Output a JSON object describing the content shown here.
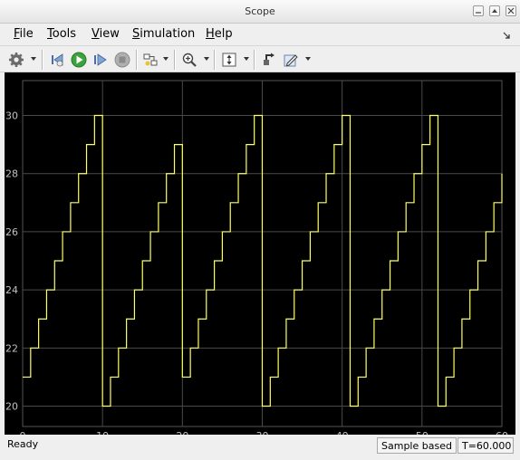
{
  "window": {
    "title": "Scope"
  },
  "menu": {
    "items": [
      {
        "label": "File",
        "u": "F",
        "rest": "ile"
      },
      {
        "label": "Tools",
        "u": "T",
        "rest": "ools"
      },
      {
        "label": "View",
        "u": "V",
        "rest": "iew"
      },
      {
        "label": "Simulation",
        "u": "S",
        "rest": "imulation"
      },
      {
        "label": "Help",
        "u": "H",
        "rest": "elp"
      }
    ]
  },
  "toolbar": {
    "buttons": [
      {
        "name": "settings",
        "icon": "gear-icon",
        "has_dropdown": true
      },
      {
        "name": "step-back",
        "icon": "step-back-icon",
        "has_dropdown": false
      },
      {
        "name": "run",
        "icon": "play-icon",
        "has_dropdown": false
      },
      {
        "name": "step-forward",
        "icon": "step-forward-icon",
        "has_dropdown": false
      },
      {
        "name": "stop",
        "icon": "stop-icon",
        "has_dropdown": false
      },
      {
        "name": "highlight-block",
        "icon": "highlight-block-icon",
        "has_dropdown": true
      },
      {
        "name": "zoom",
        "icon": "zoom-in-icon",
        "has_dropdown": true
      },
      {
        "name": "scale-axes",
        "icon": "scale-axes-icon",
        "has_dropdown": true
      },
      {
        "name": "restore",
        "icon": "restore-icon",
        "has_dropdown": false
      },
      {
        "name": "style",
        "icon": "pencil-icon",
        "has_dropdown": true
      }
    ]
  },
  "chart_data": {
    "type": "line",
    "step": true,
    "title": "",
    "xlabel": "",
    "ylabel": "",
    "xlim": [
      0,
      60
    ],
    "ylim": [
      19.3,
      31.2
    ],
    "x_ticks": [
      0,
      10,
      20,
      30,
      40,
      50,
      60
    ],
    "y_ticks": [
      20,
      22,
      24,
      26,
      28,
      30
    ],
    "grid": true,
    "background": "#000000",
    "line_color": "#ffff66",
    "grid_color": "#4a4a4a",
    "tick_label_color": "#c0c0c0",
    "series": [
      {
        "points": [
          [
            0,
            21
          ],
          [
            1,
            22
          ],
          [
            2,
            23
          ],
          [
            3,
            24
          ],
          [
            4,
            25
          ],
          [
            5,
            26
          ],
          [
            6,
            27
          ],
          [
            7,
            28
          ],
          [
            8,
            29
          ],
          [
            9,
            30
          ],
          [
            10,
            20
          ],
          [
            11,
            21
          ],
          [
            12,
            22
          ],
          [
            13,
            23
          ],
          [
            14,
            24
          ],
          [
            15,
            25
          ],
          [
            16,
            26
          ],
          [
            17,
            27
          ],
          [
            18,
            28
          ],
          [
            19,
            29
          ],
          [
            20,
            21
          ],
          [
            21,
            22
          ],
          [
            22,
            23
          ],
          [
            23,
            24
          ],
          [
            24,
            25
          ],
          [
            25,
            26
          ],
          [
            26,
            27
          ],
          [
            27,
            28
          ],
          [
            28,
            29
          ],
          [
            29,
            30
          ],
          [
            30,
            20
          ],
          [
            31,
            21
          ],
          [
            32,
            22
          ],
          [
            33,
            23
          ],
          [
            34,
            24
          ],
          [
            35,
            25
          ],
          [
            36,
            26
          ],
          [
            37,
            27
          ],
          [
            38,
            28
          ],
          [
            39,
            29
          ],
          [
            40,
            30
          ],
          [
            41,
            20
          ],
          [
            42,
            21
          ],
          [
            43,
            22
          ],
          [
            44,
            23
          ],
          [
            45,
            24
          ],
          [
            46,
            25
          ],
          [
            47,
            26
          ],
          [
            48,
            27
          ],
          [
            49,
            28
          ],
          [
            50,
            29
          ],
          [
            51,
            30
          ],
          [
            52,
            20
          ],
          [
            53,
            21
          ],
          [
            54,
            22
          ],
          [
            55,
            23
          ],
          [
            56,
            24
          ],
          [
            57,
            25
          ],
          [
            58,
            26
          ],
          [
            59,
            27
          ],
          [
            60,
            28
          ]
        ]
      }
    ]
  },
  "status": {
    "left": "Ready",
    "mode": "Sample based",
    "time": "T=60.000"
  }
}
